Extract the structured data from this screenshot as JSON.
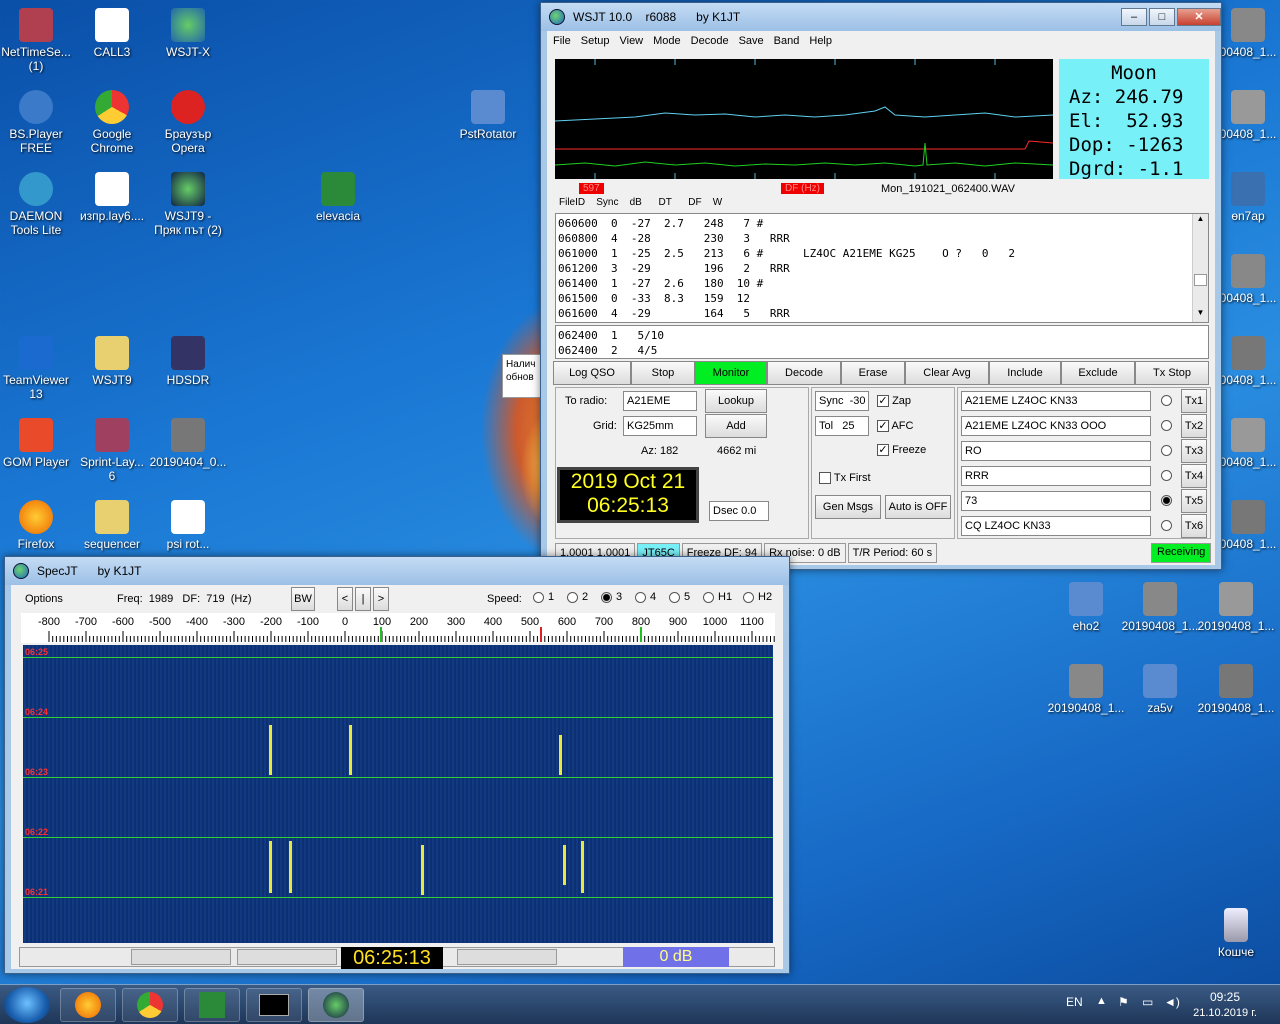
{
  "desktop": {
    "icons": [
      {
        "label": "NetTimeSe...\n(1)"
      },
      {
        "label": "CALL3"
      },
      {
        "label": "WSJT-X"
      },
      {
        "label": "BS.Player\nFREE"
      },
      {
        "label": "Google\nChrome"
      },
      {
        "label": "Браузър\nOpera"
      },
      {
        "label": "PstRotator"
      },
      {
        "label": "DAEMON\nTools Lite"
      },
      {
        "label": "изпр.lay6...."
      },
      {
        "label": "WSJT9 -\nПряк път (2)"
      },
      {
        "label": "elevacia"
      },
      {
        "label": "TeamViewer\n13"
      },
      {
        "label": "WSJT9"
      },
      {
        "label": "HDSDR"
      },
      {
        "label": "GOM Player"
      },
      {
        "label": "Sprint-Lay...\n6"
      },
      {
        "label": "20190404_0..."
      },
      {
        "label": "Firefox"
      },
      {
        "label": "sequencer"
      },
      {
        "label": "psi rot..."
      },
      {
        "label": "00408_1..."
      },
      {
        "label": "00408_1..."
      },
      {
        "label": "00408_1..."
      },
      {
        "label": "өn7ap"
      },
      {
        "label": "00408_1..."
      },
      {
        "label": "00408_1..."
      },
      {
        "label": "00408_1..."
      },
      {
        "label": "eho2"
      },
      {
        "label": "20190408_1..."
      },
      {
        "label": "20190408_1..."
      },
      {
        "label": "20190408_1..."
      },
      {
        "label": "za5v"
      },
      {
        "label": "20190408_1..."
      },
      {
        "label": "Кошче"
      }
    ],
    "notice": "Налич обнов"
  },
  "wsjt": {
    "title": "WSJT 10.0    r6088      by K1JT",
    "menu": [
      "File",
      "Setup",
      "View",
      "Mode",
      "Decode",
      "Save",
      "Band",
      "Help"
    ],
    "moon": {
      "line1": "Moon",
      "line2": "Az: 246.79",
      "line3": "El:  52.93",
      "line4": "Dop: -1263",
      "line5": "Dgrd: -1.1"
    },
    "marker_left": "597",
    "marker_right": "DF (Hz)",
    "wav": "Mon_191021_062400.WAV",
    "columns": "FileID    Sync    dB      DT      DF    W",
    "decodes": "060600  0  -27  2.7   248   7 #\n060800  4  -28        230   3   RRR\n061000  1  -25  2.5   213   6 #      LZ4OC A21EME KG25    O ?   0   2\n061200  3  -29        196   2   RRR\n061400  1  -27  2.6   180  10 #\n061500  0  -33  8.3   159  12\n061600  4  -29        164   5   RRR",
    "averages": "062400  1   5/10\n062400  2   4/5",
    "buttons": [
      "Log QSO",
      "Stop",
      "Monitor",
      "Decode",
      "Erase",
      "Clear Avg",
      "Include",
      "Exclude",
      "Tx Stop"
    ],
    "to_radio_label": "To radio:",
    "to_radio": "A21EME",
    "grid_label": "Grid:",
    "grid": "KG25mm",
    "lookup": "Lookup",
    "add": "Add",
    "az": "Az: 182",
    "dist": "4662 mi",
    "clock_date": "2019 Oct 21",
    "clock_time": "06:25:13",
    "dsec": "Dsec  0.0",
    "sync": "Sync  -30",
    "tol": "Tol   25",
    "zap": "Zap",
    "afc": "AFC",
    "freeze": "Freeze",
    "txfirst": "Tx First",
    "genmsgs": "Gen Msgs",
    "auto": "Auto is OFF",
    "tx_msgs": [
      "A21EME LZ4OC KN33",
      "A21EME LZ4OC KN33 OOO",
      "RO",
      "RRR",
      "73",
      "CQ LZ4OC KN33"
    ],
    "tx_labels": [
      "Tx1",
      "Tx2",
      "Tx3",
      "Tx4",
      "Tx5",
      "Tx6"
    ],
    "tx_selected": 4,
    "status": [
      "1.0001  1.0001",
      "JT65C",
      "Freeze DF:  94",
      "Rx noise:  0 dB",
      "T/R Period: 60 s",
      "Receiving"
    ]
  },
  "spec": {
    "title": "SpecJT      by K1JT",
    "options": "Options",
    "freq": "Freq:  1989   DF:  719  (Hz)",
    "bw": "BW",
    "nav": [
      "<",
      "|",
      ">"
    ],
    "speed_label": "Speed:",
    "speeds": [
      "1",
      "2",
      "3",
      "4",
      "5",
      "H1",
      "H2"
    ],
    "speed_selected": 2,
    "scale": [
      "-800",
      "-700",
      "-600",
      "-500",
      "-400",
      "-300",
      "-200",
      "-100",
      "0",
      "100",
      "200",
      "300",
      "400",
      "500",
      "600",
      "700",
      "800",
      "900",
      "1000",
      "1100"
    ],
    "times": [
      "06:25",
      "06:24",
      "06:23",
      "06:22",
      "06:21"
    ],
    "clock": "06:25:13",
    "db": "0 dB"
  },
  "taskbar": {
    "lang": "EN",
    "time": "09:25",
    "date": "21.10.2019 г."
  }
}
